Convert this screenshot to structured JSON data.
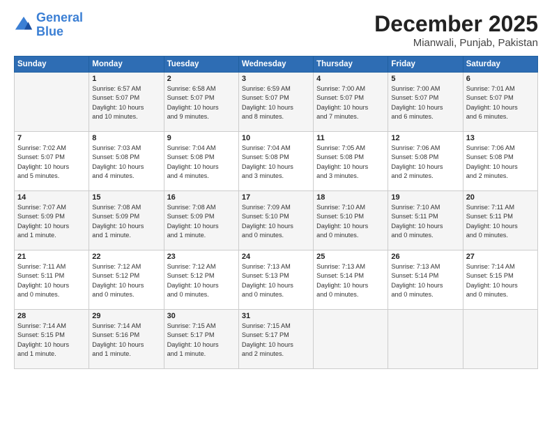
{
  "header": {
    "logo_general": "General",
    "logo_blue": "Blue",
    "month": "December 2025",
    "location": "Mianwali, Punjab, Pakistan"
  },
  "days_of_week": [
    "Sunday",
    "Monday",
    "Tuesday",
    "Wednesday",
    "Thursday",
    "Friday",
    "Saturday"
  ],
  "weeks": [
    [
      {
        "day": "",
        "info": ""
      },
      {
        "day": "1",
        "info": "Sunrise: 6:57 AM\nSunset: 5:07 PM\nDaylight: 10 hours\nand 10 minutes."
      },
      {
        "day": "2",
        "info": "Sunrise: 6:58 AM\nSunset: 5:07 PM\nDaylight: 10 hours\nand 9 minutes."
      },
      {
        "day": "3",
        "info": "Sunrise: 6:59 AM\nSunset: 5:07 PM\nDaylight: 10 hours\nand 8 minutes."
      },
      {
        "day": "4",
        "info": "Sunrise: 7:00 AM\nSunset: 5:07 PM\nDaylight: 10 hours\nand 7 minutes."
      },
      {
        "day": "5",
        "info": "Sunrise: 7:00 AM\nSunset: 5:07 PM\nDaylight: 10 hours\nand 6 minutes."
      },
      {
        "day": "6",
        "info": "Sunrise: 7:01 AM\nSunset: 5:07 PM\nDaylight: 10 hours\nand 6 minutes."
      }
    ],
    [
      {
        "day": "7",
        "info": "Sunrise: 7:02 AM\nSunset: 5:07 PM\nDaylight: 10 hours\nand 5 minutes."
      },
      {
        "day": "8",
        "info": "Sunrise: 7:03 AM\nSunset: 5:08 PM\nDaylight: 10 hours\nand 4 minutes."
      },
      {
        "day": "9",
        "info": "Sunrise: 7:04 AM\nSunset: 5:08 PM\nDaylight: 10 hours\nand 4 minutes."
      },
      {
        "day": "10",
        "info": "Sunrise: 7:04 AM\nSunset: 5:08 PM\nDaylight: 10 hours\nand 3 minutes."
      },
      {
        "day": "11",
        "info": "Sunrise: 7:05 AM\nSunset: 5:08 PM\nDaylight: 10 hours\nand 3 minutes."
      },
      {
        "day": "12",
        "info": "Sunrise: 7:06 AM\nSunset: 5:08 PM\nDaylight: 10 hours\nand 2 minutes."
      },
      {
        "day": "13",
        "info": "Sunrise: 7:06 AM\nSunset: 5:08 PM\nDaylight: 10 hours\nand 2 minutes."
      }
    ],
    [
      {
        "day": "14",
        "info": "Sunrise: 7:07 AM\nSunset: 5:09 PM\nDaylight: 10 hours\nand 1 minute."
      },
      {
        "day": "15",
        "info": "Sunrise: 7:08 AM\nSunset: 5:09 PM\nDaylight: 10 hours\nand 1 minute."
      },
      {
        "day": "16",
        "info": "Sunrise: 7:08 AM\nSunset: 5:09 PM\nDaylight: 10 hours\nand 1 minute."
      },
      {
        "day": "17",
        "info": "Sunrise: 7:09 AM\nSunset: 5:10 PM\nDaylight: 10 hours\nand 0 minutes."
      },
      {
        "day": "18",
        "info": "Sunrise: 7:10 AM\nSunset: 5:10 PM\nDaylight: 10 hours\nand 0 minutes."
      },
      {
        "day": "19",
        "info": "Sunrise: 7:10 AM\nSunset: 5:11 PM\nDaylight: 10 hours\nand 0 minutes."
      },
      {
        "day": "20",
        "info": "Sunrise: 7:11 AM\nSunset: 5:11 PM\nDaylight: 10 hours\nand 0 minutes."
      }
    ],
    [
      {
        "day": "21",
        "info": "Sunrise: 7:11 AM\nSunset: 5:11 PM\nDaylight: 10 hours\nand 0 minutes."
      },
      {
        "day": "22",
        "info": "Sunrise: 7:12 AM\nSunset: 5:12 PM\nDaylight: 10 hours\nand 0 minutes."
      },
      {
        "day": "23",
        "info": "Sunrise: 7:12 AM\nSunset: 5:12 PM\nDaylight: 10 hours\nand 0 minutes."
      },
      {
        "day": "24",
        "info": "Sunrise: 7:13 AM\nSunset: 5:13 PM\nDaylight: 10 hours\nand 0 minutes."
      },
      {
        "day": "25",
        "info": "Sunrise: 7:13 AM\nSunset: 5:14 PM\nDaylight: 10 hours\nand 0 minutes."
      },
      {
        "day": "26",
        "info": "Sunrise: 7:13 AM\nSunset: 5:14 PM\nDaylight: 10 hours\nand 0 minutes."
      },
      {
        "day": "27",
        "info": "Sunrise: 7:14 AM\nSunset: 5:15 PM\nDaylight: 10 hours\nand 0 minutes."
      }
    ],
    [
      {
        "day": "28",
        "info": "Sunrise: 7:14 AM\nSunset: 5:15 PM\nDaylight: 10 hours\nand 1 minute."
      },
      {
        "day": "29",
        "info": "Sunrise: 7:14 AM\nSunset: 5:16 PM\nDaylight: 10 hours\nand 1 minute."
      },
      {
        "day": "30",
        "info": "Sunrise: 7:15 AM\nSunset: 5:17 PM\nDaylight: 10 hours\nand 1 minute."
      },
      {
        "day": "31",
        "info": "Sunrise: 7:15 AM\nSunset: 5:17 PM\nDaylight: 10 hours\nand 2 minutes."
      },
      {
        "day": "",
        "info": ""
      },
      {
        "day": "",
        "info": ""
      },
      {
        "day": "",
        "info": ""
      }
    ]
  ]
}
